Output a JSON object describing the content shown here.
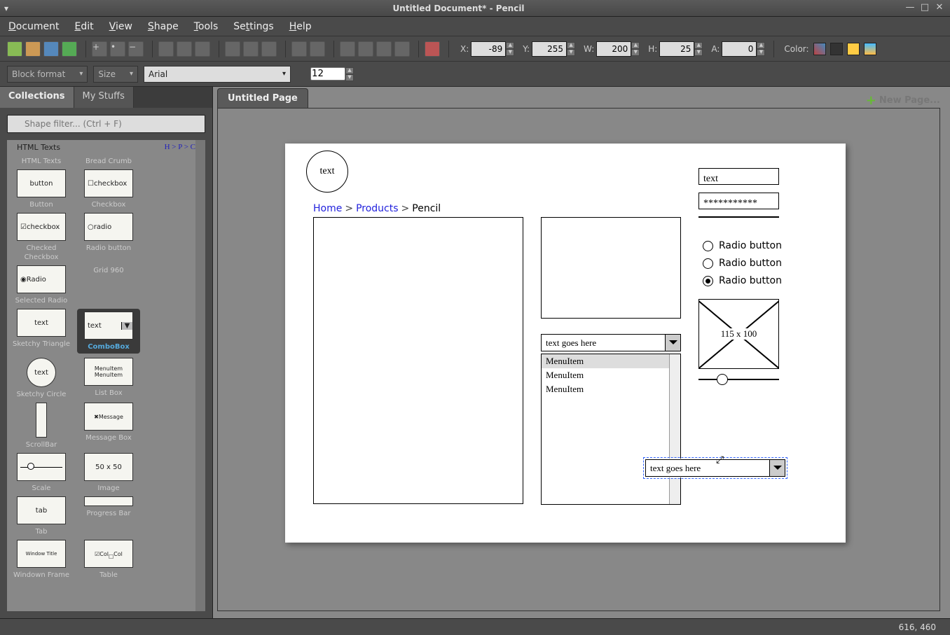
{
  "window": {
    "title": "Untitled Document* - Pencil"
  },
  "menu": {
    "items": [
      "Document",
      "Edit",
      "View",
      "Shape",
      "Tools",
      "Settings",
      "Help"
    ]
  },
  "coords": {
    "x_label": "X:",
    "x": "-89",
    "y_label": "Y:",
    "y": "255",
    "w_label": "W:",
    "w": "200",
    "h_label": "H:",
    "h": "25",
    "a_label": "A:",
    "a": "0"
  },
  "color_label": "Color:",
  "format_combo": "Block format",
  "size_combo": "Size",
  "font_combo": "Arial",
  "fontsize": "12",
  "side_tabs": {
    "collections": "Collections",
    "mystuffs": "My Stuffs"
  },
  "filter_placeholder": "Shape filter... (Ctrl + F)",
  "shape_section": "HTML Texts",
  "shape_section2": "H > P > C",
  "shapes": {
    "html_texts": "HTML Texts",
    "bread_crumb": "Bread Crumb",
    "button_thumb": "button",
    "button": "Button",
    "checkbox_thumb": "checkbox",
    "checkbox": "Checkbox",
    "checked_thumb": "checkbox",
    "checked": "Checked Checkbox",
    "radio_thumb": "radio",
    "radio_lbl": "Radio button",
    "selradio_thumb": "Radio",
    "selradio": "Selected Radio",
    "grid": "Grid 960",
    "combo_thumb": "text",
    "combo": "ComboBox",
    "tri_thumb": "text",
    "tri": "Sketchy Triangle",
    "circle_thumb": "text",
    "circle": "Sketchy Circle",
    "list_thumb": "MenuItem\nMenuItem",
    "list": "List Box",
    "msg_thumb": "Message",
    "msg": "Message Box",
    "scroll": "ScrollBar",
    "scale": "Scale",
    "img_thumb": "50 x 50",
    "img": "Image",
    "prog": "Progress Bar",
    "tab_thumb": "tab",
    "tab": "Tab",
    "win_thumb": "Window Title",
    "win": "Windown Frame",
    "tbl_thumb": "Col",
    "tbl": "Table"
  },
  "page_tab": "Untitled Page",
  "new_page": "New Page...",
  "canvas": {
    "circle_text": "text",
    "bc_home": "Home",
    "bc_products": "Products",
    "bc_pencil": "Pencil",
    "textinput": "text",
    "password": "***********",
    "radio1": "Radio button",
    "radio2": "Radio button",
    "radio3": "Radio button",
    "image_label": "115 x 100",
    "combo1": "text goes here",
    "list_item1": "MenuItem",
    "list_item2": "MenuItem",
    "list_item3": "MenuItem",
    "combo2": "text goes here"
  },
  "status": "616, 460"
}
